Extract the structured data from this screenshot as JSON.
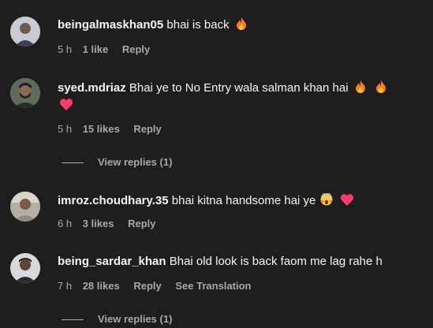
{
  "comments": [
    {
      "username": "beingalmaskhan05",
      "text": "bhai is back",
      "emojis": [
        "fire-emoji"
      ],
      "time": "5 h",
      "likes": "1 like",
      "reply": "Reply"
    },
    {
      "username": "syed.mdriaz",
      "text": "Bhai ye to No Entry wala salman khan hai",
      "emojis": [
        "fire-emoji",
        "fire-emoji",
        "heart-emoji"
      ],
      "time": "5 h",
      "likes": "15 likes",
      "reply": "Reply",
      "view_replies": "View replies (1)"
    },
    {
      "username": "imroz.choudhary.35",
      "text": "bhai kitna handsome hai ye",
      "emojis": [
        "face-screaming-emoji",
        "heart-emoji"
      ],
      "time": "6 h",
      "likes": "3 likes",
      "reply": "Reply"
    },
    {
      "username": "being_sardar_khan",
      "text": "Bhai old look is back faom me lag rahe h",
      "emojis": [],
      "time": "7 h",
      "likes": "28 likes",
      "reply": "Reply",
      "see_translation": "See Translation",
      "view_replies": "View replies (1)"
    }
  ],
  "colors": {
    "background": "#1e1e1e",
    "text": "#f5f5f5",
    "secondary": "#a8a8a8",
    "heart": "#ff3b6b",
    "fire": "#ff7a1a"
  }
}
